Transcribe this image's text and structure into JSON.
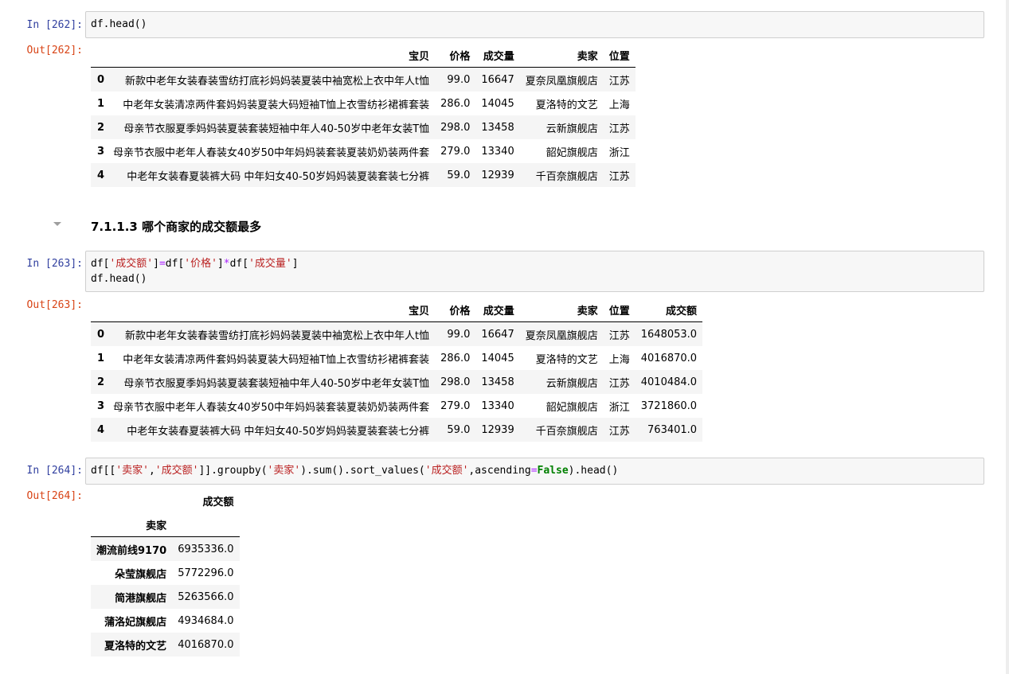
{
  "cells": [
    {
      "in_prompt": "In  [262]:",
      "code": "df.head()",
      "out_prompt": "Out[262]:",
      "columns": [
        "宝贝",
        "价格",
        "成交量",
        "卖家",
        "位置"
      ],
      "rows": [
        {
          "index": "0",
          "values": [
            "新款中老年女装春装雪纺打底衫妈妈装夏装中袖宽松上衣中年人t恤",
            "99.0",
            "16647",
            "夏奈凤凰旗舰店",
            "江苏"
          ]
        },
        {
          "index": "1",
          "values": [
            "中老年女装清凉两件套妈妈装夏装大码短袖T恤上衣雪纺衫裙裤套装",
            "286.0",
            "14045",
            "夏洛特的文艺",
            "上海"
          ]
        },
        {
          "index": "2",
          "values": [
            "母亲节衣服夏季妈妈装夏装套装短袖中年人40-50岁中老年女装T恤",
            "298.0",
            "13458",
            "云新旗舰店",
            "江苏"
          ]
        },
        {
          "index": "3",
          "values": [
            "母亲节衣服中老年人春装女40岁50中年妈妈装套装夏装奶奶装两件套",
            "279.0",
            "13340",
            "韶妃旗舰店",
            "浙江"
          ]
        },
        {
          "index": "4",
          "values": [
            "中老年女装春夏装裤大码 中年妇女40-50岁妈妈装夏装套装七分裤",
            "59.0",
            "12939",
            "千百奈旗舰店",
            "江苏"
          ]
        }
      ]
    },
    {
      "heading": "7.1.1.3  哪个商家的成交额最多",
      "in_prompt": "In  [263]:",
      "code_line1": {
        "t1": "df[",
        "s1": "'成交额'",
        "t2": "]",
        "op1": "=",
        "t3": "df[",
        "s2": "'价格'",
        "t4": "]",
        "op2": "*",
        "t5": "df[",
        "s3": "'成交量'",
        "t6": "]"
      },
      "code_line2": "df.head()",
      "out_prompt": "Out[263]:",
      "columns": [
        "宝贝",
        "价格",
        "成交量",
        "卖家",
        "位置",
        "成交额"
      ],
      "rows": [
        {
          "index": "0",
          "values": [
            "新款中老年女装春装雪纺打底衫妈妈装夏装中袖宽松上衣中年人t恤",
            "99.0",
            "16647",
            "夏奈凤凰旗舰店",
            "江苏",
            "1648053.0"
          ]
        },
        {
          "index": "1",
          "values": [
            "中老年女装清凉两件套妈妈装夏装大码短袖T恤上衣雪纺衫裙裤套装",
            "286.0",
            "14045",
            "夏洛特的文艺",
            "上海",
            "4016870.0"
          ]
        },
        {
          "index": "2",
          "values": [
            "母亲节衣服夏季妈妈装夏装套装短袖中年人40-50岁中老年女装T恤",
            "298.0",
            "13458",
            "云新旗舰店",
            "江苏",
            "4010484.0"
          ]
        },
        {
          "index": "3",
          "values": [
            "母亲节衣服中老年人春装女40岁50中年妈妈装套装夏装奶奶装两件套",
            "279.0",
            "13340",
            "韶妃旗舰店",
            "浙江",
            "3721860.0"
          ]
        },
        {
          "index": "4",
          "values": [
            "中老年女装春夏装裤大码 中年妇女40-50岁妈妈装夏装套装七分裤",
            "59.0",
            "12939",
            "千百奈旗舰店",
            "江苏",
            "763401.0"
          ]
        }
      ]
    },
    {
      "in_prompt": "In  [264]:",
      "code": {
        "t1": "df[[",
        "s1": "'卖家'",
        "t2": ",",
        "s2": "'成交额'",
        "t3": "]].groupby(",
        "s3": "'卖家'",
        "t4": ").sum().sort_values(",
        "s4": "'成交额'",
        "t5": ",ascending",
        "op1": "=",
        "kw1": "False",
        "t6": ").head()"
      },
      "out_prompt": "Out[264]:",
      "value_column": "成交额",
      "index_name": "卖家",
      "rows": [
        {
          "index": "潮流前线9170",
          "value": "6935336.0"
        },
        {
          "index": "朵莹旗舰店",
          "value": "5772296.0"
        },
        {
          "index": "简港旗舰店",
          "value": "5263566.0"
        },
        {
          "index": "蒲洛妃旗舰店",
          "value": "4934684.0"
        },
        {
          "index": "夏洛特的文艺",
          "value": "4016870.0"
        }
      ]
    }
  ]
}
